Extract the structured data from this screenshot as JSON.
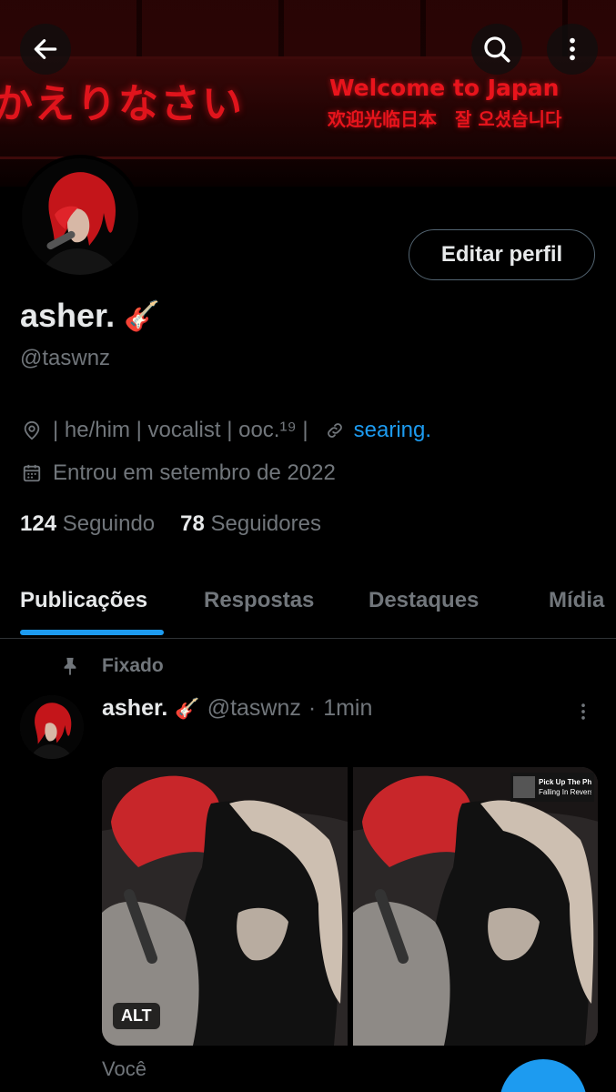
{
  "banner": {
    "jp_text": "かえりなさい",
    "en_text": "Welcome to Japan",
    "multi_text": "欢迎光临日本　잘 오셨습니다"
  },
  "header": {
    "back_icon": "arrow-left-icon",
    "search_icon": "search-icon",
    "more_icon": "more-vertical-icon"
  },
  "profile": {
    "edit_label": "Editar perfil",
    "name": "asher.",
    "name_emoji": "🎸",
    "handle": "@taswnz",
    "bio_location": "| he/him | vocalist | ooc.¹⁹ |",
    "bio_link": "searing.",
    "joined": "Entrou em setembro de 2022",
    "following_count": "124",
    "following_label": "Seguindo",
    "followers_count": "78",
    "followers_label": "Seguidores"
  },
  "tabs": [
    {
      "label": "Publicações",
      "active": true
    },
    {
      "label": "Respostas",
      "active": false
    },
    {
      "label": "Destaques",
      "active": false
    },
    {
      "label": "Mídia",
      "active": false
    }
  ],
  "post": {
    "pinned_label": "Fixado",
    "author_name": "asher.",
    "author_emoji": "🎸",
    "author_handle": "@taswnz",
    "separator": "·",
    "time": "1min",
    "alt_label": "ALT",
    "music_title": "Pick Up The Phon",
    "music_artist": "Falling In Reverse",
    "footer_text": "Você"
  },
  "colors": {
    "accent": "#1d9bf0",
    "muted": "#71767b",
    "text": "#e7e9ea",
    "banner_red": "#e0141c"
  }
}
